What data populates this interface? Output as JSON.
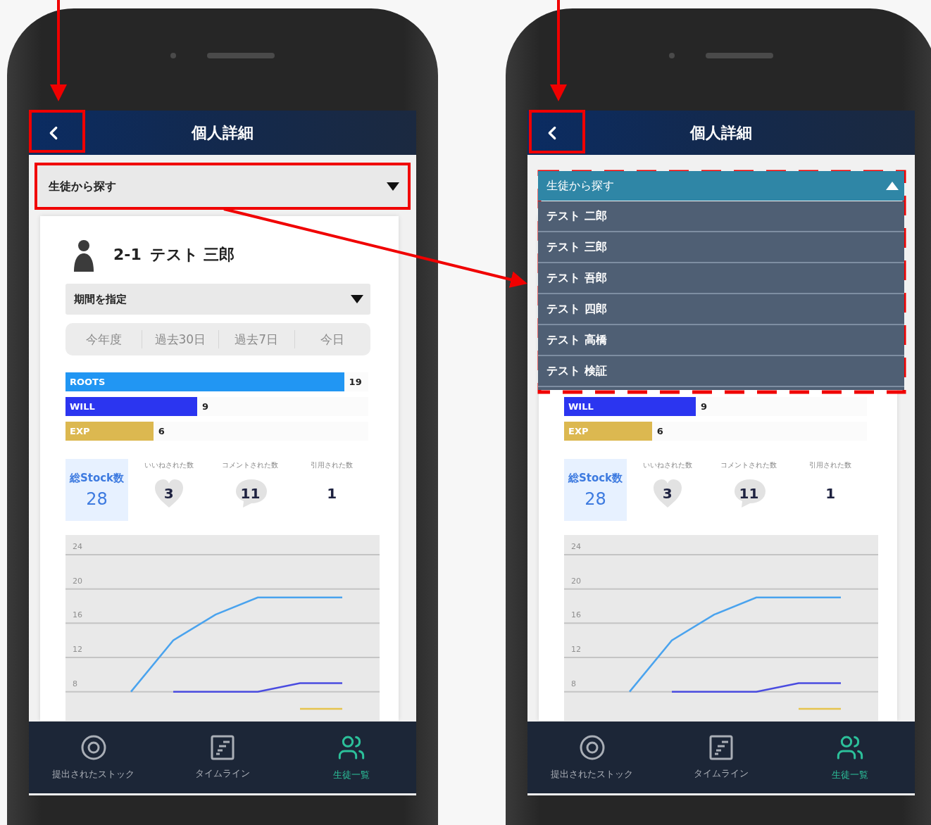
{
  "screens": [
    {
      "header": {
        "title": "個人詳細"
      },
      "student_select": {
        "label": "生徒から探す",
        "expanded": false
      },
      "profile": {
        "class": "2-1",
        "name": "テスト 三郎"
      },
      "period_select": {
        "label": "期間を指定"
      },
      "periods": [
        "今年度",
        "過去30日",
        "過去7日",
        "今日"
      ],
      "bars": [
        {
          "label": "ROOTS",
          "value": "19",
          "level": 0.92,
          "color": "#2196f3"
        },
        {
          "label": "WILL",
          "value": "9",
          "level": 0.435,
          "color": "#2b35f0"
        },
        {
          "label": "EXP",
          "value": "6",
          "level": 0.29,
          "color": "#dcb850"
        }
      ],
      "stats": {
        "total": {
          "label": "総Stock数",
          "value": "28"
        },
        "items": [
          {
            "kind": "heart",
            "label": "いいねされた数",
            "value": "3"
          },
          {
            "kind": "bubble",
            "label": "コメントされた数",
            "value": "11"
          },
          {
            "kind": "plain",
            "label": "引用された数",
            "value": "1"
          }
        ]
      },
      "chart_data": {
        "type": "line",
        "grid": true,
        "yticks": [
          8,
          12,
          16,
          20,
          24
        ],
        "ylim": [
          4.6,
          26.3
        ],
        "series": [
          {
            "color": "#4aa3ee",
            "values": [
              null,
              8,
              14,
              17,
              19,
              19,
              19
            ]
          },
          {
            "color": "#4a4ce0",
            "values": [
              null,
              null,
              8,
              8,
              8,
              9,
              9
            ]
          },
          {
            "color": "#e6c44e",
            "values": [
              null,
              null,
              null,
              null,
              null,
              6,
              6
            ]
          }
        ]
      },
      "nav": [
        {
          "kind": "target",
          "label": "提出されたストック",
          "selected": false
        },
        {
          "kind": "timeline",
          "label": "タイムライン",
          "selected": false
        },
        {
          "kind": "people",
          "label": "生徒一覧",
          "selected": true
        }
      ]
    },
    {
      "header": {
        "title": "個人詳細"
      },
      "student_select": {
        "label": "生徒から探す",
        "expanded": true,
        "options": [
          "テスト 二郎",
          "テスト 三郎",
          "テスト 吾郎",
          "テスト 四郎",
          "テスト 高橋",
          "テスト 検証"
        ]
      },
      "bars": [
        {
          "label": "WILL",
          "value": "9",
          "level": 0.435,
          "color": "#2b35f0"
        },
        {
          "label": "EXP",
          "value": "6",
          "level": 0.29,
          "color": "#dcb850"
        }
      ],
      "stats": {
        "total": {
          "label": "総Stock数",
          "value": "28"
        },
        "items": [
          {
            "kind": "heart",
            "label": "いいねされた数",
            "value": "3"
          },
          {
            "kind": "bubble",
            "label": "コメントされた数",
            "value": "11"
          },
          {
            "kind": "plain",
            "label": "引用された数",
            "value": "1"
          }
        ]
      },
      "chart_data": {
        "type": "line",
        "grid": true,
        "yticks": [
          8,
          12,
          16,
          20,
          24
        ],
        "ylim": [
          4.6,
          26.3
        ],
        "series": [
          {
            "color": "#4aa3ee",
            "values": [
              null,
              8,
              14,
              17,
              19,
              19,
              19
            ]
          },
          {
            "color": "#4a4ce0",
            "values": [
              null,
              null,
              8,
              8,
              8,
              9,
              9
            ]
          },
          {
            "color": "#e6c44e",
            "values": [
              null,
              null,
              null,
              null,
              null,
              6,
              6
            ]
          }
        ]
      },
      "nav": [
        {
          "kind": "target",
          "label": "提出されたストック",
          "selected": false
        },
        {
          "kind": "timeline",
          "label": "タイムライン",
          "selected": false
        },
        {
          "kind": "people",
          "label": "生徒一覧",
          "selected": true
        }
      ]
    }
  ]
}
